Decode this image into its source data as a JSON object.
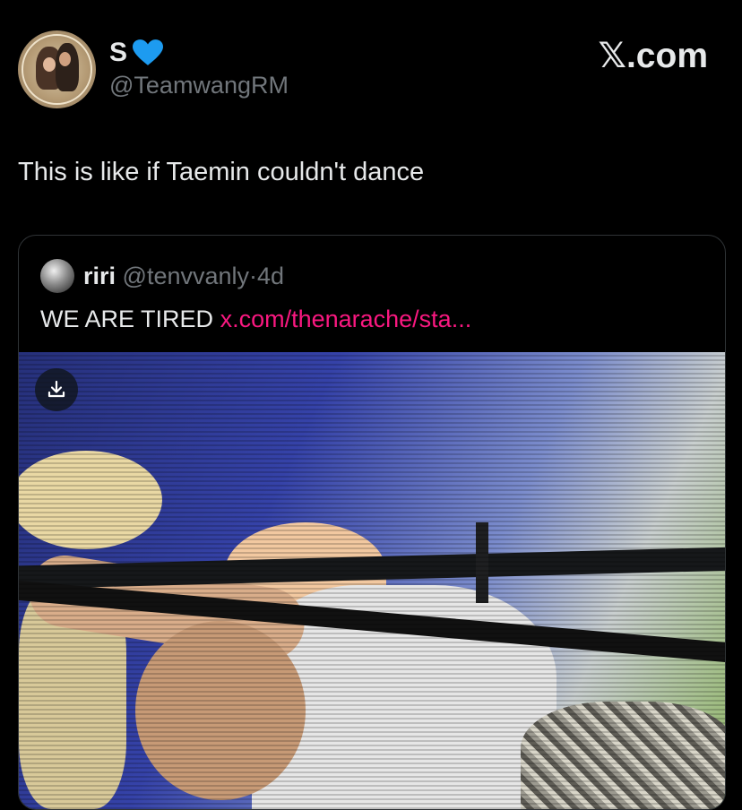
{
  "author": {
    "display_name": "S",
    "verified_emoji": "blue-heart",
    "handle": "@TeamwangRM"
  },
  "brand": "𝕏.com",
  "tweet": {
    "text": "This is like if Taemin couldn't dance"
  },
  "quoted_tweet": {
    "name": "riri",
    "handle": "@tenvvanly",
    "separator": "·",
    "age": "4d",
    "text": "WE ARE TIRED",
    "link": "x.com/thenarache/sta..."
  },
  "media": {
    "download_icon": "download-icon"
  },
  "colors": {
    "background": "#000000",
    "text": "#e7e9ea",
    "muted": "#71767b",
    "link": "#f91880",
    "heart": "#1d9bf0"
  }
}
